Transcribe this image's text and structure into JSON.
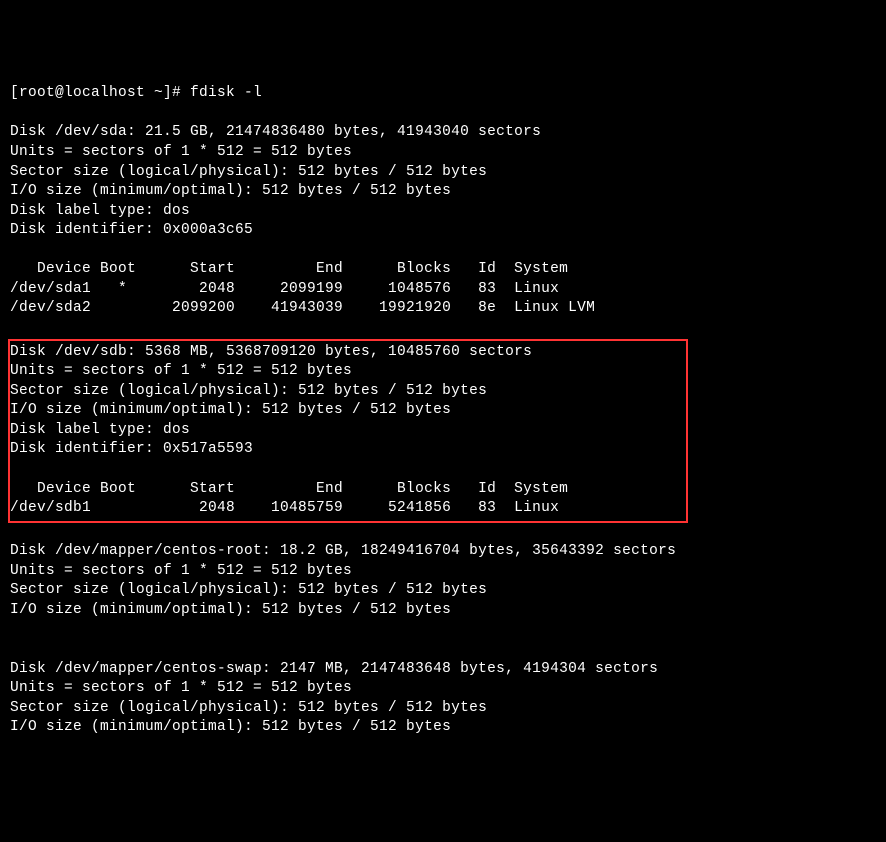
{
  "prompt": "[root@localhost ~]# fdisk -l",
  "blank": "",
  "sda": {
    "header": "Disk /dev/sda: 21.5 GB, 21474836480 bytes, 41943040 sectors",
    "units": "Units = sectors of 1 * 512 = 512 bytes",
    "sector_size": "Sector size (logical/physical): 512 bytes / 512 bytes",
    "io_size": "I/O size (minimum/optimal): 512 bytes / 512 bytes",
    "label_type": "Disk label type: dos",
    "identifier": "Disk identifier: 0x000a3c65",
    "table_header": "   Device Boot      Start         End      Blocks   Id  System",
    "rows": [
      "/dev/sda1   *        2048     2099199     1048576   83  Linux",
      "/dev/sda2         2099200    41943039    19921920   8e  Linux LVM"
    ]
  },
  "sdb": {
    "header": "Disk /dev/sdb: 5368 MB, 5368709120 bytes, 10485760 sectors",
    "units": "Units = sectors of 1 * 512 = 512 bytes",
    "sector_size": "Sector size (logical/physical): 512 bytes / 512 bytes",
    "io_size": "I/O size (minimum/optimal): 512 bytes / 512 bytes",
    "label_type": "Disk label type: dos",
    "identifier": "Disk identifier: 0x517a5593",
    "table_header": "   Device Boot      Start         End      Blocks   Id  System",
    "rows": [
      "/dev/sdb1            2048    10485759     5241856   83  Linux"
    ]
  },
  "centos_root": {
    "header": "Disk /dev/mapper/centos-root: 18.2 GB, 18249416704 bytes, 35643392 sectors",
    "units": "Units = sectors of 1 * 512 = 512 bytes",
    "sector_size": "Sector size (logical/physical): 512 bytes / 512 bytes",
    "io_size": "I/O size (minimum/optimal): 512 bytes / 512 bytes"
  },
  "centos_swap": {
    "header": "Disk /dev/mapper/centos-swap: 2147 MB, 2147483648 bytes, 4194304 sectors",
    "units": "Units = sectors of 1 * 512 = 512 bytes",
    "sector_size": "Sector size (logical/physical): 512 bytes / 512 bytes",
    "io_size": "I/O size (minimum/optimal): 512 bytes / 512 bytes"
  }
}
